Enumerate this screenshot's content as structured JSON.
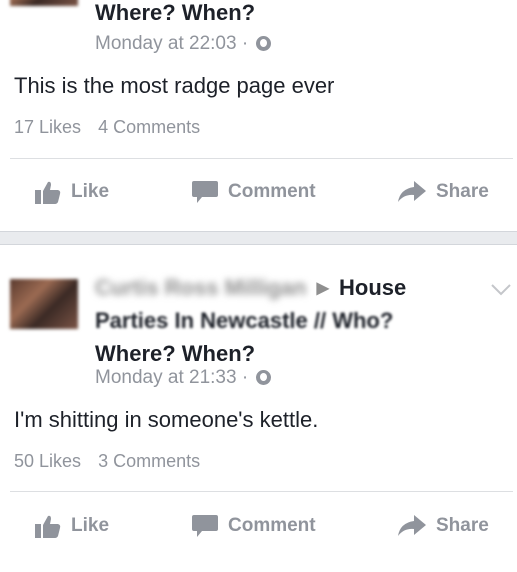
{
  "posts": [
    {
      "header_line3": "Where? When?",
      "timestamp": "Monday at 22:03",
      "separator": "·",
      "privacy_icon": "globe-icon",
      "body": "This is the most radge page ever",
      "likes": "17 Likes",
      "comments": "4 Comments"
    },
    {
      "author": "Curtis Ross Milligan",
      "group_line1": "House",
      "group_line2": "Parties In Newcastle // Who?",
      "header_line3": "Where? When?",
      "timestamp": "Monday at 21:33",
      "separator": "·",
      "privacy_icon": "globe-icon",
      "body": "I'm shitting in someone's kettle.",
      "likes": "50 Likes",
      "comments": "3 Comments"
    }
  ],
  "actions": {
    "like": "Like",
    "comment": "Comment",
    "share": "Share"
  },
  "colors": {
    "muted": "#90949c",
    "text": "#1d2129",
    "separator_bg": "#e9ebee"
  }
}
